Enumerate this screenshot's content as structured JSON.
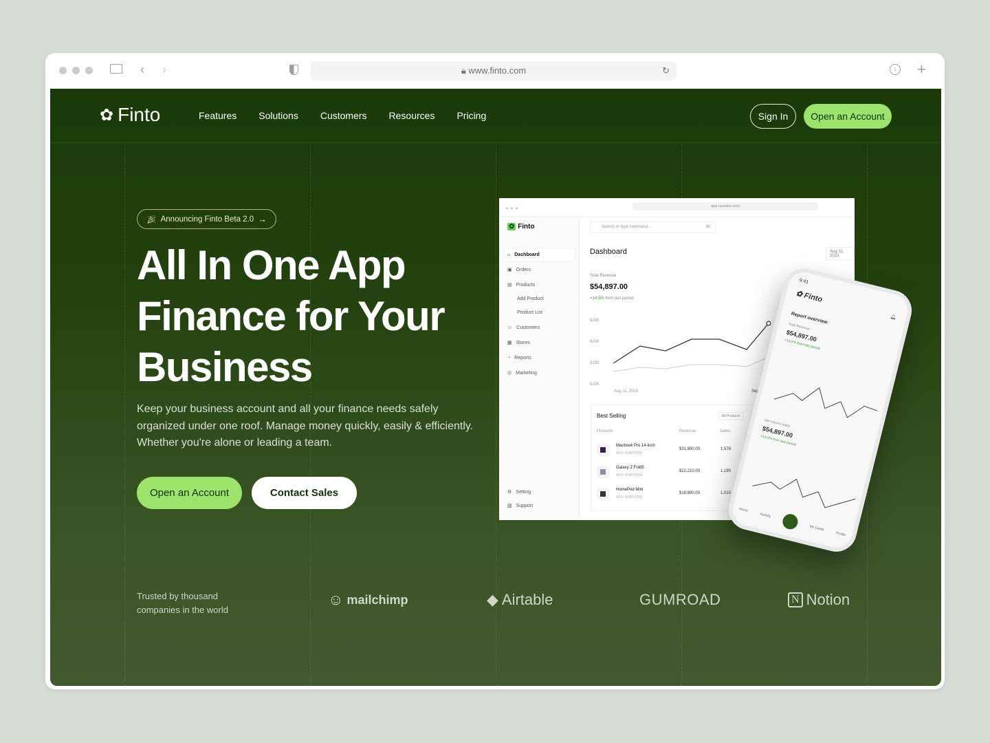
{
  "browser": {
    "url": "www.finto.com"
  },
  "nav": {
    "brand": "Finto",
    "links": [
      "Features",
      "Solutions",
      "Customers",
      "Resources",
      "Pricing"
    ],
    "sign_in": "Sign In",
    "open_account": "Open an Account"
  },
  "hero": {
    "badge": "Announcing Finto Beta 2.0",
    "title": "All In One App Finance for Your Business",
    "subtitle": "Keep your business account and all your finance needs safely organized under one roof. Manage money quickly, easily & efficiently. Whether you're alone or leading a team.",
    "primary_cta": "Open an Account",
    "secondary_cta": "Contact Sales"
  },
  "trust": {
    "text": "Trusted by thousand companies in the world",
    "logos": [
      "mailchimp",
      "Airtable",
      "GUMROAD",
      "Notion"
    ]
  },
  "colors": {
    "accent": "#9be36a",
    "bg_top": "#1a3a09",
    "bg_bottom": "#42592f"
  },
  "dashboard": {
    "url": "app.nusales.com",
    "brand": "Finto",
    "search_placeholder": "Search or type command...",
    "shortcut": "⌘/",
    "title": "Dashboard",
    "date": "Aug 11, 2023",
    "sidebar": [
      "Dashboard",
      "Orders",
      "Products",
      "Add Product",
      "Product List",
      "Customers",
      "Stores",
      "Reports",
      "Marketing"
    ],
    "sidebar_bottom": [
      "Setting",
      "Support"
    ],
    "revenue_label": "Total Revenue",
    "revenue": "$54,897.00",
    "change": "+14,5%",
    "change_text": "from last period",
    "y_ticks": [
      "$25K",
      "$20K",
      "$15K",
      "$10K"
    ],
    "x_ticks": [
      "Aug 11, 2023",
      "Sep"
    ],
    "best_selling": {
      "title": "Best Selling",
      "filter": "All Products",
      "columns": [
        "Products",
        "Revenue",
        "Sales"
      ],
      "rows": [
        {
          "name": "Macbook Pro 14-inch",
          "sku": "SKU: 009876526",
          "revenue": "$31,890.00",
          "sales": "1,578"
        },
        {
          "name": "Galaxy Z Fold5",
          "sku": "SKU: 009876334",
          "revenue": "$22,210.00",
          "sales": "1,190"
        },
        {
          "name": "HomePod Mini",
          "sku": "SKU: 009876526",
          "revenue": "$18,890.00",
          "sales": "1,010"
        }
      ]
    }
  },
  "phone": {
    "time": "9:41",
    "brand": "Finto",
    "section": "Report overview",
    "label1": "Total Revenue",
    "value1": "$54,897.00",
    "change1": "+14,5% from last period",
    "label2": "Net volume sales",
    "value2": "$54,897.00",
    "change2": "+14,5% from last period",
    "tabs": [
      "Home",
      "Activity",
      "My Cards",
      "Profile"
    ]
  }
}
